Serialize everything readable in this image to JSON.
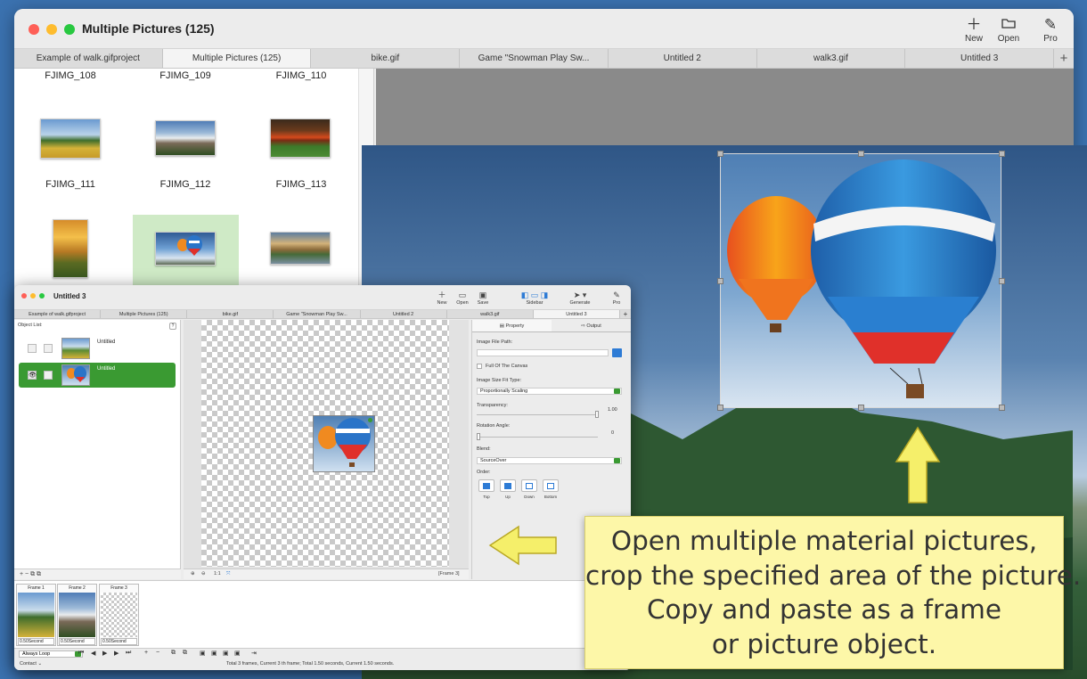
{
  "main_window": {
    "title": "Multiple Pictures (125)",
    "toolbar": {
      "new_label": "New",
      "open_label": "Open",
      "pro_label": "Pro"
    },
    "tabs": [
      "Example of walk.gifproject",
      "Multiple Pictures (125)",
      "bike.gif",
      "Game \"Snowman Play Sw...",
      "Untitled 2",
      "walk3.gif",
      "Untitled 3"
    ],
    "active_tab": "Multiple Pictures (125)",
    "add_tab_label": "+",
    "thumbnails": {
      "row1_labels": [
        "FJIMG_108",
        "FJIMG_109",
        "FJIMG_110"
      ],
      "row2_labels": [
        "FJIMG_111",
        "FJIMG_112",
        "FJIMG_113"
      ],
      "selected": "hot-air-balloons"
    }
  },
  "sub_window": {
    "title": "Untitled 3",
    "toolbar": {
      "new_label": "New",
      "open_label": "Open",
      "save_label": "Save",
      "sidebar_label": "Sidebar",
      "generate_label": "Generate",
      "pro_label": "Pro"
    },
    "tabs": [
      "Example of walk.gifproject",
      "Multiple Pictures (125)",
      "bike.gif",
      "Game \"Snowman Play Sw...",
      "Untitled 2",
      "walk3.gif",
      "Untitled 3"
    ],
    "add_tab_label": "+",
    "object_list": {
      "label": "Object List:",
      "help": "?",
      "items": [
        {
          "name": "Untitled",
          "selected": false
        },
        {
          "name": "Untitled",
          "selected": true
        }
      ],
      "footer": "+  −   ⧉  ⧉"
    },
    "canvas_footer": {
      "zoom_in": "⊕",
      "zoom_out": "⊖",
      "actual": "1:1",
      "fit": "⤧",
      "frame_label": "[Frame 3]"
    },
    "property_panel": {
      "tab_property": "Property",
      "tab_output": "Output",
      "image_file_path_label": "Image File Path:",
      "full_canvas_label": "Full Of The Canvas",
      "fit_type_label": "Image Size Fit Type:",
      "fit_type_value": "Proportionally Scaling",
      "transparency_label": "Transparency:",
      "transparency_value": "1.00",
      "rotation_label": "Rotation Angle:",
      "rotation_value": "0",
      "blend_label": "Blend:",
      "blend_value": "SourceOver",
      "order_label": "Order:",
      "order_buttons": [
        "Top",
        "Up",
        "Down",
        "Bottom"
      ]
    },
    "frames": [
      {
        "label": "Frame 1",
        "duration": "0.50Second"
      },
      {
        "label": "Frame 2",
        "duration": "0.50Second"
      },
      {
        "label": "Frame 3",
        "duration": "0.50Second"
      }
    ],
    "playback": {
      "loop_value": "Always Loop"
    },
    "status": {
      "contact_label": "Contact",
      "text": "Total 3 frames, Current 3 th frame; Total 1.50 seconds, Current 1.50 seconds."
    }
  },
  "caption": {
    "lines": [
      "Open multiple material pictures,",
      "crop the specified area of the picture.",
      "Copy and paste as a frame",
      "or picture object."
    ]
  },
  "colors": {
    "note_bg": "#fdf7a8",
    "arrow": "#f5ef6a",
    "selection_green": "#3a9a32",
    "thumb_selected": "#cfeac6"
  }
}
